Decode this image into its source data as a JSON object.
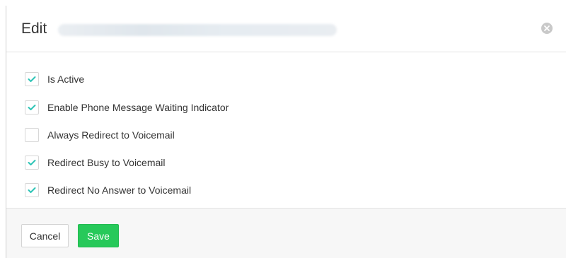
{
  "dialog": {
    "title": "Edit",
    "close_icon": "close-circle-icon"
  },
  "options": [
    {
      "label": "Is Active",
      "checked": true
    },
    {
      "label": "Enable Phone Message Waiting Indicator",
      "checked": true
    },
    {
      "label": "Always Redirect to Voicemail",
      "checked": false
    },
    {
      "label": "Redirect Busy to Voicemail",
      "checked": true
    },
    {
      "label": "Redirect No Answer to Voicemail",
      "checked": true
    }
  ],
  "footer": {
    "cancel_label": "Cancel",
    "save_label": "Save"
  },
  "colors": {
    "check_accent": "#2ec4b6",
    "save_button": "#27c95a"
  }
}
